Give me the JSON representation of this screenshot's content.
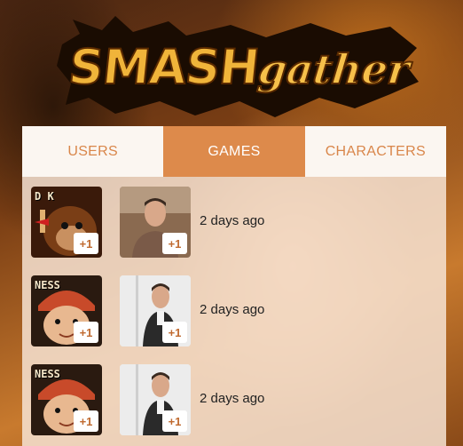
{
  "logo": {
    "main": "SMASH",
    "sub": "gather"
  },
  "tabs": [
    {
      "label": "USERS",
      "active": false
    },
    {
      "label": "GAMES",
      "active": true
    },
    {
      "label": "CHARACTERS",
      "active": false
    }
  ],
  "games": [
    {
      "character": "DK",
      "character_label": "D K",
      "char_plus": "+1",
      "user_plus": "+1",
      "time": "2 days ago"
    },
    {
      "character": "Ness",
      "character_label": "NESS",
      "char_plus": "+1",
      "user_plus": "+1",
      "time": "2 days ago"
    },
    {
      "character": "Ness",
      "character_label": "NESS",
      "char_plus": "+1",
      "user_plus": "+1",
      "time": "2 days ago"
    }
  ],
  "colors": {
    "accent": "#dd8a4b",
    "tab_bg": "#fbf6f1"
  }
}
